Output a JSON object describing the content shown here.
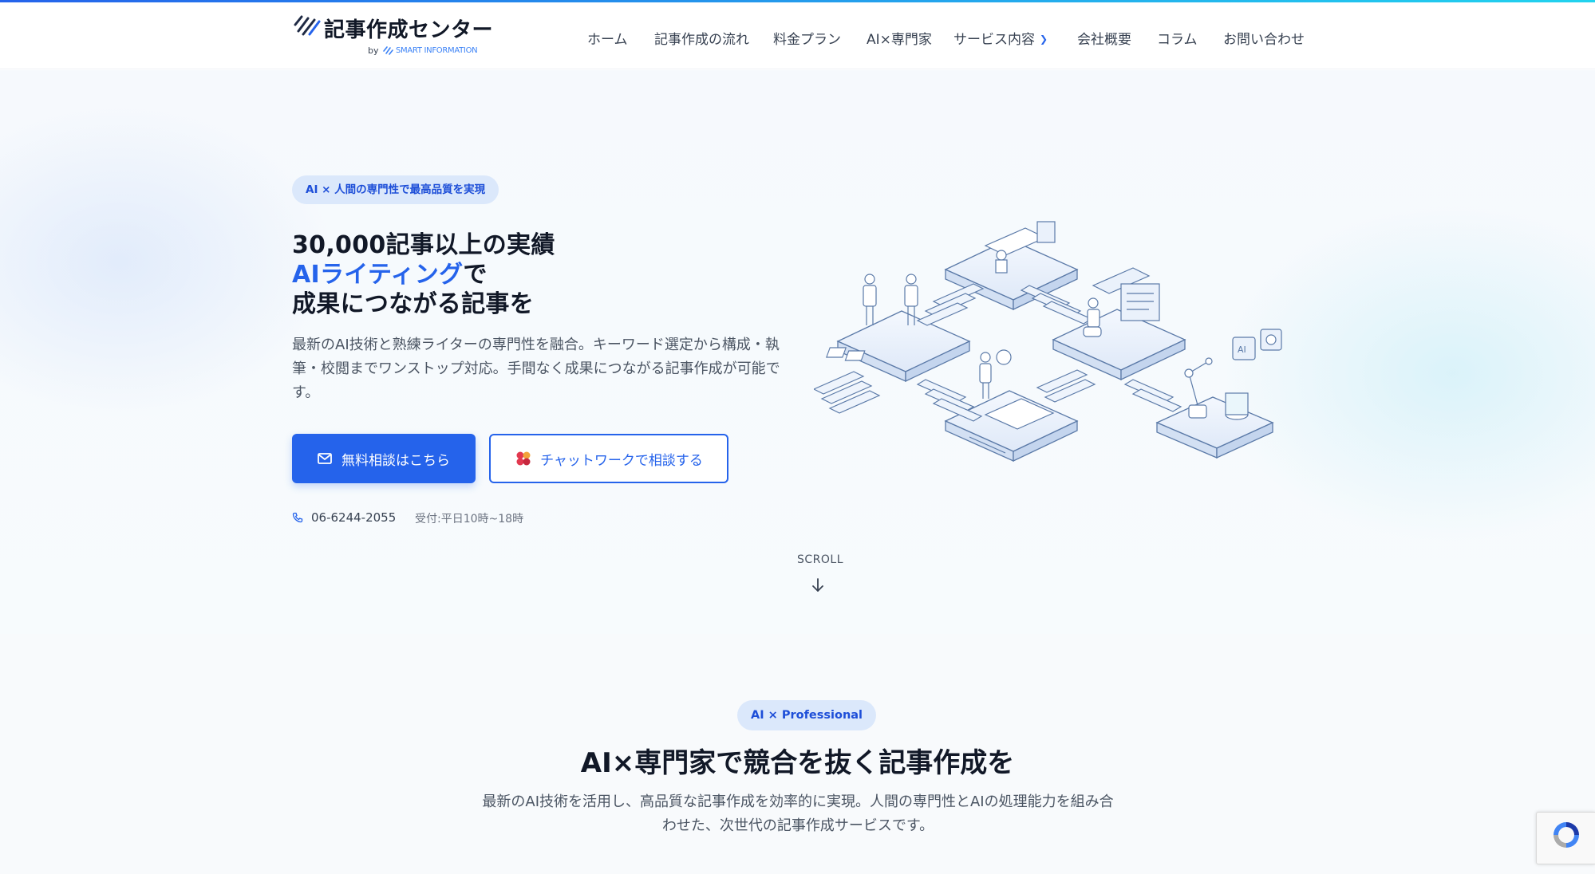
{
  "brand": {
    "name": "記事作成センター",
    "by": "by",
    "sub": "SMART INFORMATION"
  },
  "nav": {
    "items": [
      {
        "label": "ホーム"
      },
      {
        "label": "記事作成の流れ"
      },
      {
        "label": "料金プラン"
      },
      {
        "label": "AI×専門家"
      },
      {
        "label": "サービス内容",
        "has_dropdown": true
      },
      {
        "label": "会社概要"
      },
      {
        "label": "コラム"
      },
      {
        "label": "お問い合わせ"
      }
    ]
  },
  "hero": {
    "badge": "AI × 人間の専門性で最高品質を実現",
    "title_line1": "30,000記事以上の実績",
    "title_line2_accent": "AIライティング",
    "title_line2_rest": "で",
    "title_line3": "成果につながる記事を",
    "lead": "最新のAI技術と熟練ライターの専門性を融合。キーワード選定から構成・執筆・校閲までワンストップ対応。手間なく成果につながる記事作成が可能です。",
    "primary_button": "無料相談はこちら",
    "secondary_button": "チャットワークで相談する",
    "phone": "06-6244-2055",
    "hours": "受付:平日10時~18時",
    "scroll": "SCROLL"
  },
  "section2": {
    "pill": "AI × Professional",
    "title": "AI×専門家で競合を抜く記事作成を",
    "subtitle": "最新のAI技術を活用し、高品質な記事作成を効率的に実現。人間の専門性とAIの処理能力を組み合わせた、次世代の記事作成サービスです。"
  },
  "colors": {
    "accent": "#2563eb",
    "badge_bg": "#dbe8fb",
    "text": "#111827",
    "muted": "#4b5563"
  },
  "icons": {
    "mail": "mail-icon",
    "chatwork": "chatwork-icon",
    "phone": "phone-icon",
    "scroll": "arrow-down-icon",
    "dropdown": "chevron-down-icon"
  }
}
